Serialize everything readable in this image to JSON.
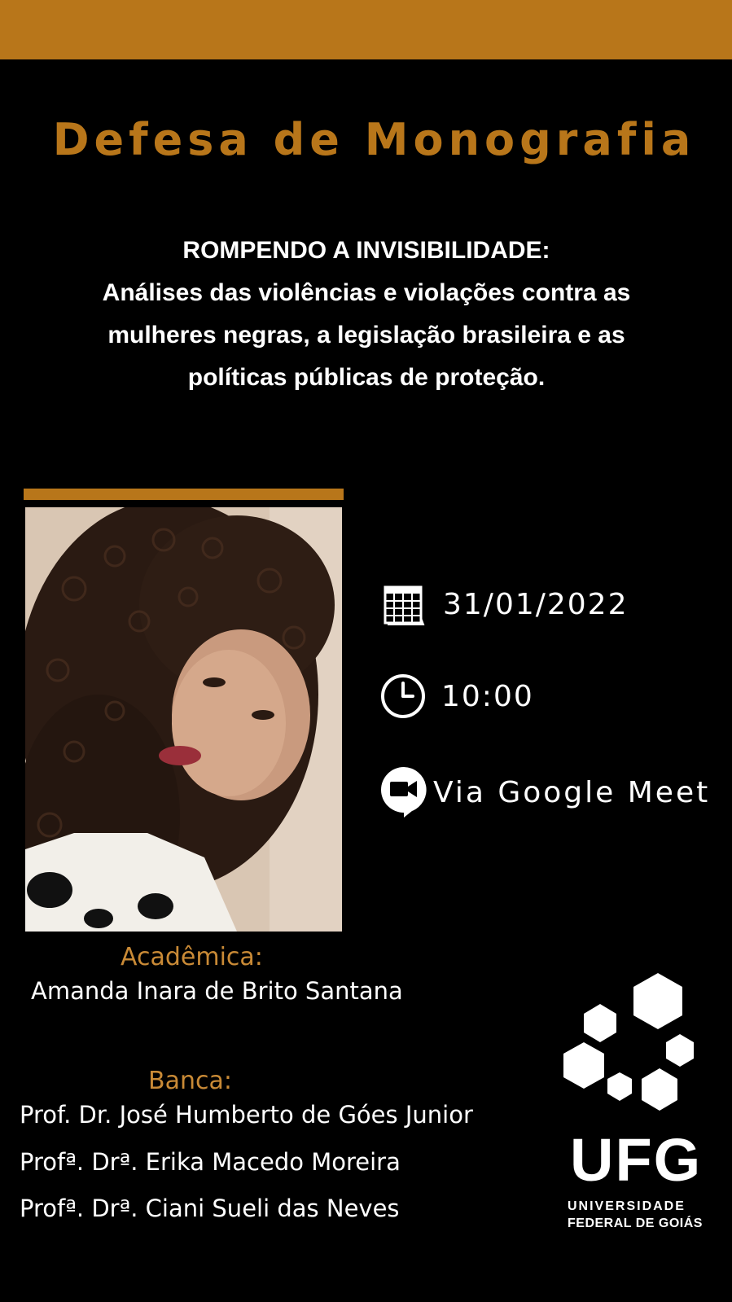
{
  "header": {
    "title": "Defesa de Monografia"
  },
  "thesis": {
    "lines": [
      "ROMPENDO A INVISIBILIDADE:",
      "Análises das violências e violações contra as",
      "mulheres negras, a legislação brasileira e as",
      "políticas públicas de proteção."
    ]
  },
  "event": {
    "date": "31/01/2022",
    "time": "10:00",
    "platform": "Via Google Meet",
    "icons": [
      "calendar-icon",
      "clock-icon",
      "video-chat-icon"
    ]
  },
  "student": {
    "label": "Acadêmica:",
    "name": "Amanda Inara de Brito Santana"
  },
  "committee": {
    "label": "Banca:",
    "members": [
      "Prof. Dr. José Humberto de Góes Junior",
      "Profª. Drª. Erika Macedo Moreira",
      "Profª. Drª. Ciani Sueli das Neves"
    ]
  },
  "institution": {
    "acronym": "UFG",
    "line1": "UNIVERSIDADE",
    "line2": "FEDERAL DE GOIÁS"
  },
  "colors": {
    "accent": "#b8761a",
    "background": "#000000",
    "label": "#c98a36"
  }
}
